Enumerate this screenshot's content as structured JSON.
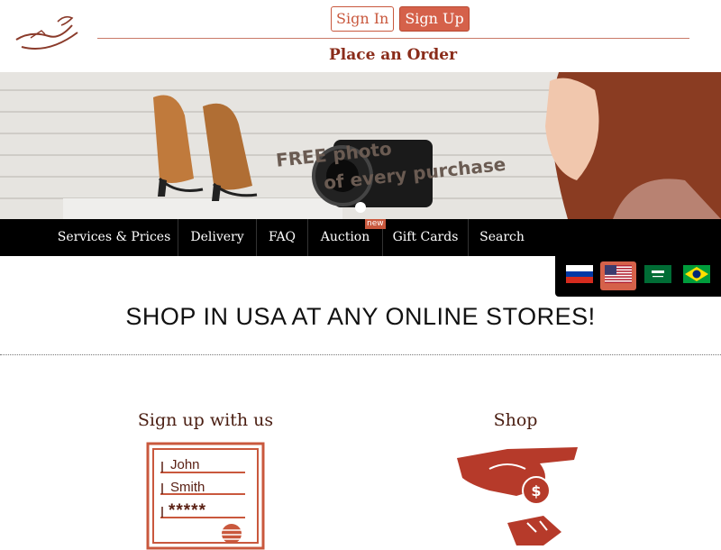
{
  "header": {
    "sign_in": "Sign In",
    "sign_up": "Sign Up",
    "place_order": "Place an Order"
  },
  "banner": {
    "promo_line1": "FREE photo",
    "promo_line2": "of every purchase"
  },
  "nav": {
    "items": [
      {
        "label": "Services & Prices"
      },
      {
        "label": "Delivery"
      },
      {
        "label": "FAQ"
      },
      {
        "label": "Auction"
      },
      {
        "label": "Gift Cards"
      },
      {
        "label": "Search"
      }
    ],
    "new_badge": "new"
  },
  "languages": [
    "russian-flag-icon",
    "us-flag-icon",
    "saudi-flag-icon",
    "brazil-flag-icon"
  ],
  "main": {
    "headline": "SHOP IN USA AT ANY ONLINE STORES!",
    "steps": [
      {
        "title": "Sign up with us",
        "form_first": "John",
        "form_last": "Smith",
        "form_password": "*****"
      },
      {
        "title": "Shop"
      }
    ]
  },
  "colors": {
    "accent": "#c9583d",
    "dark_red": "#8a2c1a",
    "nav_bg": "#000000"
  }
}
